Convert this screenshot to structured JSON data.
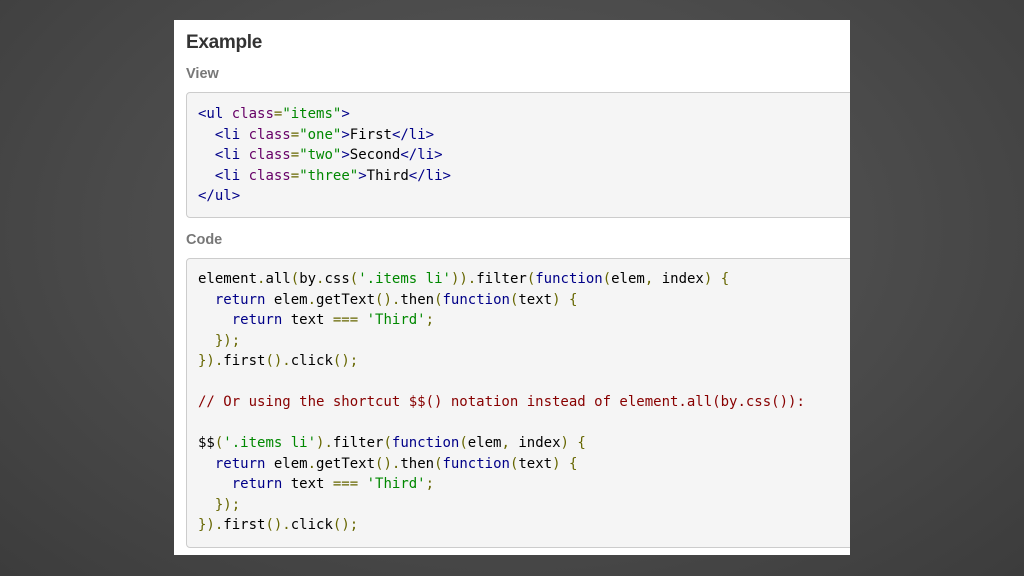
{
  "heading": "Example",
  "view": {
    "label": "View",
    "lines": [
      [
        [
          "tag",
          "<ul"
        ],
        [
          "pln",
          " "
        ],
        [
          "atn",
          "class"
        ],
        [
          "pun",
          "="
        ],
        [
          "atv",
          "\"items\""
        ],
        [
          "tag",
          ">"
        ]
      ],
      [
        [
          "pln",
          "  "
        ],
        [
          "tag",
          "<li"
        ],
        [
          "pln",
          " "
        ],
        [
          "atn",
          "class"
        ],
        [
          "pun",
          "="
        ],
        [
          "atv",
          "\"one\""
        ],
        [
          "tag",
          ">"
        ],
        [
          "pln",
          "First"
        ],
        [
          "tag",
          "</li>"
        ]
      ],
      [
        [
          "pln",
          "  "
        ],
        [
          "tag",
          "<li"
        ],
        [
          "pln",
          " "
        ],
        [
          "atn",
          "class"
        ],
        [
          "pun",
          "="
        ],
        [
          "atv",
          "\"two\""
        ],
        [
          "tag",
          ">"
        ],
        [
          "pln",
          "Second"
        ],
        [
          "tag",
          "</li>"
        ]
      ],
      [
        [
          "pln",
          "  "
        ],
        [
          "tag",
          "<li"
        ],
        [
          "pln",
          " "
        ],
        [
          "atn",
          "class"
        ],
        [
          "pun",
          "="
        ],
        [
          "atv",
          "\"three\""
        ],
        [
          "tag",
          ">"
        ],
        [
          "pln",
          "Third"
        ],
        [
          "tag",
          "</li>"
        ]
      ],
      [
        [
          "tag",
          "</ul>"
        ]
      ]
    ]
  },
  "code": {
    "label": "Code",
    "lines": [
      [
        [
          "pln",
          "element"
        ],
        [
          "pun",
          "."
        ],
        [
          "pln",
          "all"
        ],
        [
          "pun",
          "("
        ],
        [
          "pln",
          "by"
        ],
        [
          "pun",
          "."
        ],
        [
          "pln",
          "css"
        ],
        [
          "pun",
          "("
        ],
        [
          "str",
          "'.items li'"
        ],
        [
          "pun",
          "))."
        ],
        [
          "pln",
          "filter"
        ],
        [
          "pun",
          "("
        ],
        [
          "kwd",
          "function"
        ],
        [
          "pun",
          "("
        ],
        [
          "pln",
          "elem"
        ],
        [
          "pun",
          ","
        ],
        [
          "pln",
          " index"
        ],
        [
          "pun",
          ")"
        ],
        [
          "pln",
          " "
        ],
        [
          "pun",
          "{"
        ]
      ],
      [
        [
          "pln",
          "  "
        ],
        [
          "kwd",
          "return"
        ],
        [
          "pln",
          " elem"
        ],
        [
          "pun",
          "."
        ],
        [
          "pln",
          "getText"
        ],
        [
          "pun",
          "()."
        ],
        [
          "pln",
          "then"
        ],
        [
          "pun",
          "("
        ],
        [
          "kwd",
          "function"
        ],
        [
          "pun",
          "("
        ],
        [
          "pln",
          "text"
        ],
        [
          "pun",
          ")"
        ],
        [
          "pln",
          " "
        ],
        [
          "pun",
          "{"
        ]
      ],
      [
        [
          "pln",
          "    "
        ],
        [
          "kwd",
          "return"
        ],
        [
          "pln",
          " text "
        ],
        [
          "pun",
          "==="
        ],
        [
          "pln",
          " "
        ],
        [
          "str",
          "'Third'"
        ],
        [
          "pun",
          ";"
        ]
      ],
      [
        [
          "pln",
          "  "
        ],
        [
          "pun",
          "});"
        ]
      ],
      [
        [
          "pun",
          "})."
        ],
        [
          "pln",
          "first"
        ],
        [
          "pun",
          "()."
        ],
        [
          "pln",
          "click"
        ],
        [
          "pun",
          "();"
        ]
      ],
      [],
      [
        [
          "com",
          "// Or using the shortcut $$() notation instead of element.all(by.css()):"
        ]
      ],
      [],
      [
        [
          "pln",
          "$$"
        ],
        [
          "pun",
          "("
        ],
        [
          "str",
          "'.items li'"
        ],
        [
          "pun",
          ")."
        ],
        [
          "pln",
          "filter"
        ],
        [
          "pun",
          "("
        ],
        [
          "kwd",
          "function"
        ],
        [
          "pun",
          "("
        ],
        [
          "pln",
          "elem"
        ],
        [
          "pun",
          ","
        ],
        [
          "pln",
          " index"
        ],
        [
          "pun",
          ")"
        ],
        [
          "pln",
          " "
        ],
        [
          "pun",
          "{"
        ]
      ],
      [
        [
          "pln",
          "  "
        ],
        [
          "kwd",
          "return"
        ],
        [
          "pln",
          " elem"
        ],
        [
          "pun",
          "."
        ],
        [
          "pln",
          "getText"
        ],
        [
          "pun",
          "()."
        ],
        [
          "pln",
          "then"
        ],
        [
          "pun",
          "("
        ],
        [
          "kwd",
          "function"
        ],
        [
          "pun",
          "("
        ],
        [
          "pln",
          "text"
        ],
        [
          "pun",
          ")"
        ],
        [
          "pln",
          " "
        ],
        [
          "pun",
          "{"
        ]
      ],
      [
        [
          "pln",
          "    "
        ],
        [
          "kwd",
          "return"
        ],
        [
          "pln",
          " text "
        ],
        [
          "pun",
          "==="
        ],
        [
          "pln",
          " "
        ],
        [
          "str",
          "'Third'"
        ],
        [
          "pun",
          ";"
        ]
      ],
      [
        [
          "pln",
          "  "
        ],
        [
          "pun",
          "});"
        ]
      ],
      [
        [
          "pun",
          "})."
        ],
        [
          "pln",
          "first"
        ],
        [
          "pun",
          "()."
        ],
        [
          "pln",
          "click"
        ],
        [
          "pun",
          "();"
        ]
      ]
    ]
  }
}
